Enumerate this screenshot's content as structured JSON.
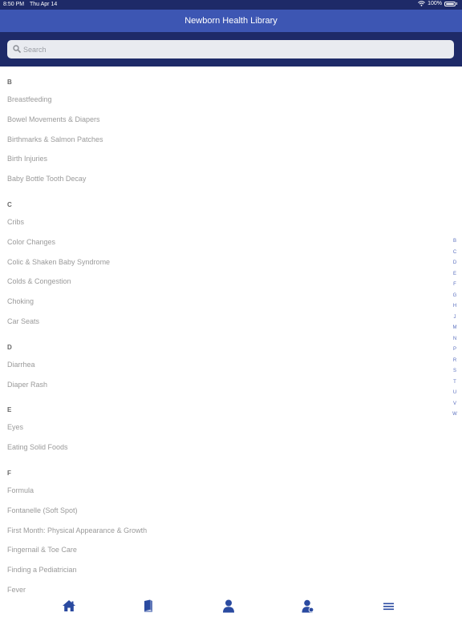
{
  "status": {
    "time": "8:50 PM",
    "date": "Thu Apr 14",
    "battery": "100%"
  },
  "nav": {
    "title": "Newborn Health Library"
  },
  "search": {
    "placeholder": "Search"
  },
  "sections": [
    {
      "letter": "B",
      "items": [
        "Breastfeeding",
        "Bowel Movements & Diapers",
        "Birthmarks & Salmon Patches",
        "Birth Injuries",
        "Baby Bottle Tooth Decay"
      ]
    },
    {
      "letter": "C",
      "items": [
        "Cribs",
        "Color Changes",
        "Colic & Shaken Baby Syndrome",
        "Colds & Congestion",
        "Choking",
        "Car Seats"
      ]
    },
    {
      "letter": "D",
      "items": [
        "Diarrhea",
        "Diaper Rash"
      ]
    },
    {
      "letter": "E",
      "items": [
        "Eyes",
        "Eating Solid Foods"
      ]
    },
    {
      "letter": "F",
      "items": [
        "Formula",
        "Fontanelle (Soft Spot)",
        "First Month: Physical Appearance & Growth",
        "Fingernail & Toe Care",
        "Finding a Pediatrician",
        "Fever"
      ]
    }
  ],
  "index": [
    "B",
    "C",
    "D",
    "E",
    "F",
    "G",
    "H",
    "J",
    "M",
    "N",
    "P",
    "R",
    "S",
    "T",
    "U",
    "V",
    "W"
  ],
  "tabs": [
    {
      "icon": "home-icon"
    },
    {
      "icon": "book-icon"
    },
    {
      "icon": "person-icon"
    },
    {
      "icon": "doctor-icon"
    },
    {
      "icon": "menu-icon"
    }
  ],
  "colors": {
    "header_dark": "#1e2a68",
    "header": "#3d56b3",
    "accent": "#2a4aa0"
  }
}
